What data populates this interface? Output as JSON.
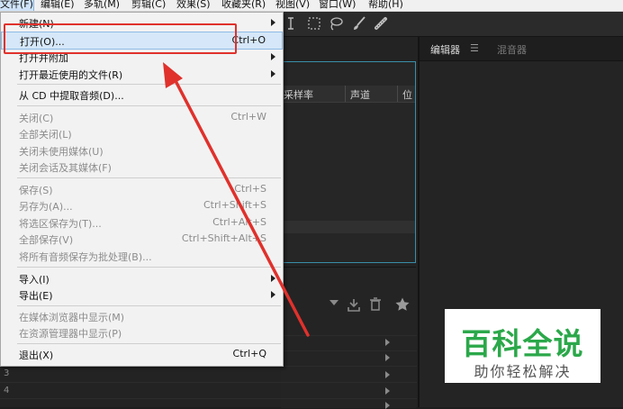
{
  "menubar": {
    "items": [
      {
        "label": "文件(F)",
        "active": true
      },
      {
        "label": "编辑(E)"
      },
      {
        "label": "多轨(M)"
      },
      {
        "label": "剪辑(C)"
      },
      {
        "label": "效果(S)"
      },
      {
        "label": "收藏夹(R)"
      },
      {
        "label": "视图(V)"
      },
      {
        "label": "窗口(W)"
      },
      {
        "label": "帮助(H)"
      }
    ]
  },
  "toolbar": {
    "icons": [
      "text-cursor-icon",
      "marquee-icon",
      "lasso-icon",
      "brush-icon",
      "healing-icon"
    ]
  },
  "files_panel": {
    "columns": [
      "采样率",
      "声道",
      "位"
    ]
  },
  "right_panel": {
    "tabs": [
      "编辑器",
      "混音器"
    ],
    "tab_menu": "☰"
  },
  "lower_rows": [
    "3",
    "4"
  ],
  "file_menu": {
    "items": [
      {
        "label": "新建(N)",
        "shortcut": "",
        "submenu": true,
        "disabled": false
      },
      {
        "label": "打开(O)...",
        "shortcut": "Ctrl+O",
        "submenu": false,
        "disabled": false,
        "highlighted": true
      },
      {
        "label": "打开并附加",
        "shortcut": "",
        "submenu": true,
        "disabled": false
      },
      {
        "label": "打开最近使用的文件(R)",
        "shortcut": "",
        "submenu": true,
        "disabled": false
      },
      {
        "label": "从 CD 中提取音频(D)...",
        "shortcut": "",
        "submenu": false,
        "disabled": false
      },
      {
        "label": "关闭(C)",
        "shortcut": "Ctrl+W",
        "submenu": false,
        "disabled": true
      },
      {
        "label": "全部关闭(L)",
        "shortcut": "",
        "submenu": false,
        "disabled": true
      },
      {
        "label": "关闭未使用媒体(U)",
        "shortcut": "",
        "submenu": false,
        "disabled": true
      },
      {
        "label": "关闭会话及其媒体(F)",
        "shortcut": "",
        "submenu": false,
        "disabled": true
      },
      {
        "label": "保存(S)",
        "shortcut": "Ctrl+S",
        "submenu": false,
        "disabled": true
      },
      {
        "label": "另存为(A)...",
        "shortcut": "Ctrl+Shift+S",
        "submenu": false,
        "disabled": true
      },
      {
        "label": "将选区保存为(T)...",
        "shortcut": "Ctrl+Alt+S",
        "submenu": false,
        "disabled": true
      },
      {
        "label": "全部保存(V)",
        "shortcut": "Ctrl+Shift+Alt+S",
        "submenu": false,
        "disabled": true
      },
      {
        "label": "将所有音频保存为批处理(B)...",
        "shortcut": "",
        "submenu": false,
        "disabled": true
      },
      {
        "label": "导入(I)",
        "shortcut": "",
        "submenu": true,
        "disabled": false
      },
      {
        "label": "导出(E)",
        "shortcut": "",
        "submenu": true,
        "disabled": false
      },
      {
        "label": "在媒体浏览器中显示(M)",
        "shortcut": "",
        "submenu": false,
        "disabled": true
      },
      {
        "label": "在资源管理器中显示(P)",
        "shortcut": "",
        "submenu": false,
        "disabled": true
      },
      {
        "label": "退出(X)",
        "shortcut": "Ctrl+Q",
        "submenu": false,
        "disabled": false
      }
    ]
  },
  "watermark": {
    "title": "百科全说",
    "subtitle": "助你轻松解决"
  },
  "colors": {
    "annotation_red": "#e0312c",
    "menu_highlight": "#d5e7f8",
    "watermark_green": "#2ba84a"
  }
}
